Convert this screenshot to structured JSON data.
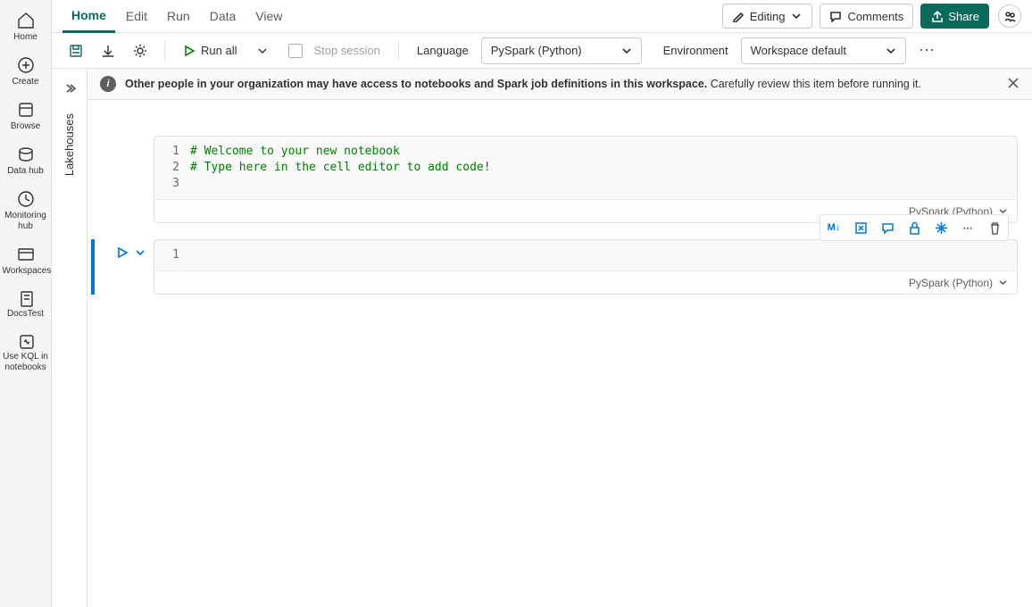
{
  "leftnav": {
    "items": [
      {
        "label": "Home"
      },
      {
        "label": "Create"
      },
      {
        "label": "Browse"
      },
      {
        "label": "Data hub"
      },
      {
        "label": "Monitoring hub"
      },
      {
        "label": "Workspaces"
      },
      {
        "label": "DocsTest"
      },
      {
        "label": "Use KQL in notebooks"
      }
    ]
  },
  "tabs": {
    "items": [
      "Home",
      "Edit",
      "Run",
      "Data",
      "View"
    ],
    "editing": "Editing",
    "comments": "Comments",
    "share": "Share"
  },
  "toolbar": {
    "run_all": "Run all",
    "stop_session": "Stop session",
    "language_label": "Language",
    "language_value": "PySpark (Python)",
    "environment_label": "Environment",
    "environment_value": "Workspace default"
  },
  "sidepanel": {
    "label": "Lakehouses"
  },
  "banner": {
    "bold": "Other people in your organization may have access to notebooks and Spark job definitions in this workspace.",
    "rest": " Carefully review this item before running it."
  },
  "cells": [
    {
      "lines": [
        {
          "n": "1",
          "text": "# Welcome to your new notebook",
          "cls": "comment"
        },
        {
          "n": "2",
          "text": "# Type here in the cell editor to add code!",
          "cls": "comment"
        },
        {
          "n": "3",
          "text": "",
          "cls": ""
        }
      ],
      "lang": "PySpark (Python)",
      "active": false
    },
    {
      "lines": [
        {
          "n": "1",
          "text": "",
          "cls": ""
        }
      ],
      "lang": "PySpark (Python)",
      "active": true
    }
  ],
  "cell_toolbar": {
    "md": "M↓"
  }
}
